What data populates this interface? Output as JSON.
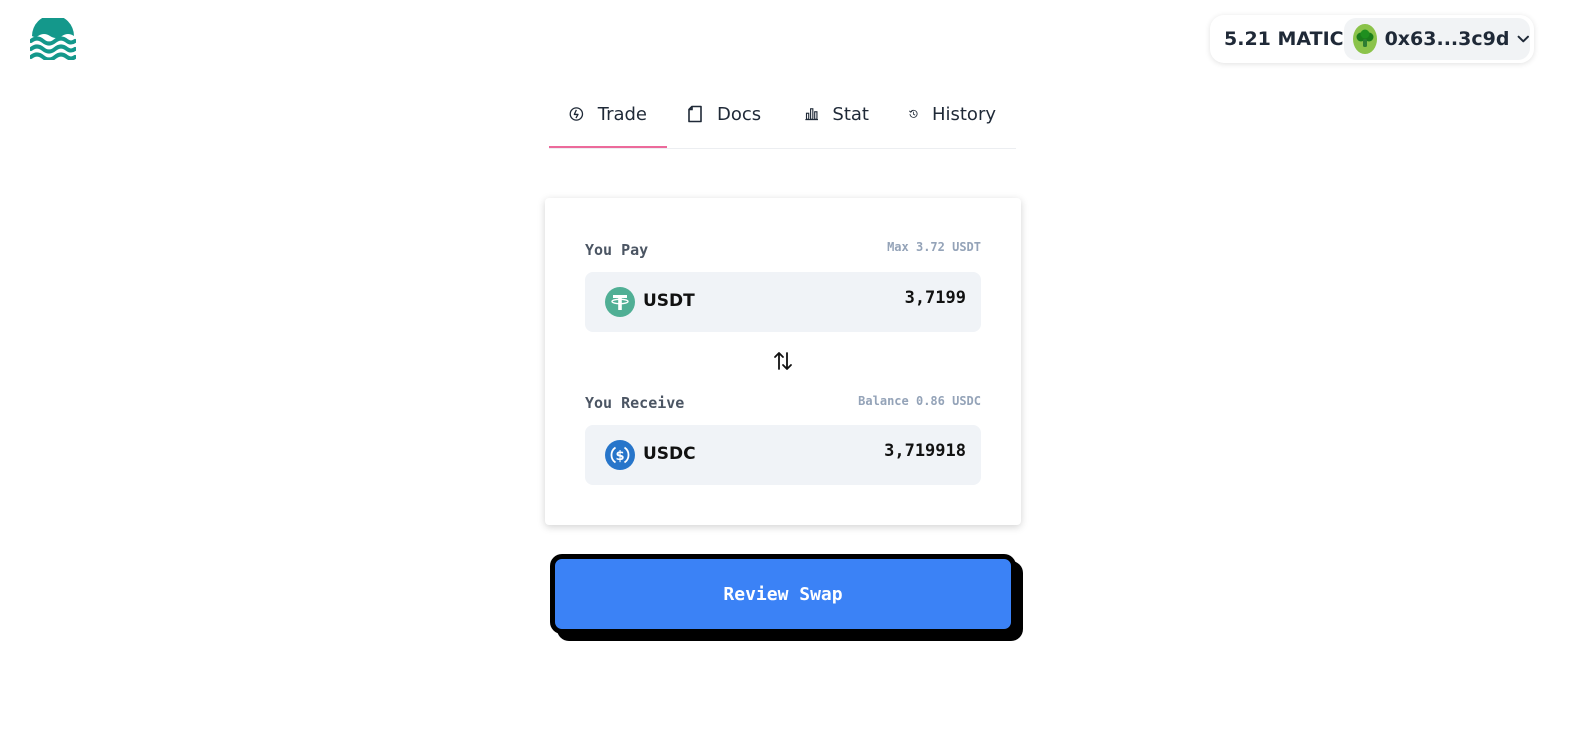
{
  "header": {
    "logo_icon": "waves-logo-icon",
    "brand_color": "#14988b",
    "wallet": {
      "balance": "5.21 MATIC",
      "address": "0x63...3c9d",
      "avatar_icon": "broccoli-avatar-icon",
      "dropdown_icon": "chevron-down-icon"
    }
  },
  "nav": {
    "accent_color": "#ec6a9b",
    "tabs": [
      {
        "label": "Trade",
        "icon": "trade-icon",
        "active": true
      },
      {
        "label": "Docs",
        "icon": "document-icon",
        "active": false
      },
      {
        "label": "Stat",
        "icon": "bar-chart-icon",
        "active": false
      },
      {
        "label": "History",
        "icon": "history-icon",
        "active": false
      }
    ]
  },
  "swap": {
    "pay": {
      "label": "You Pay",
      "meta": "Max 3.72 USDT",
      "token": "USDT",
      "token_icon": "usdt-icon",
      "amount": "3,7199"
    },
    "switch_icon": "swap-arrows-icon",
    "receive": {
      "label": "You Receive",
      "meta": "Balance 0.86 USDC",
      "token": "USDC",
      "token_icon": "usdc-icon",
      "amount": "3,719918"
    },
    "review_button": "Review Swap",
    "button_color": "#3b82f6"
  }
}
